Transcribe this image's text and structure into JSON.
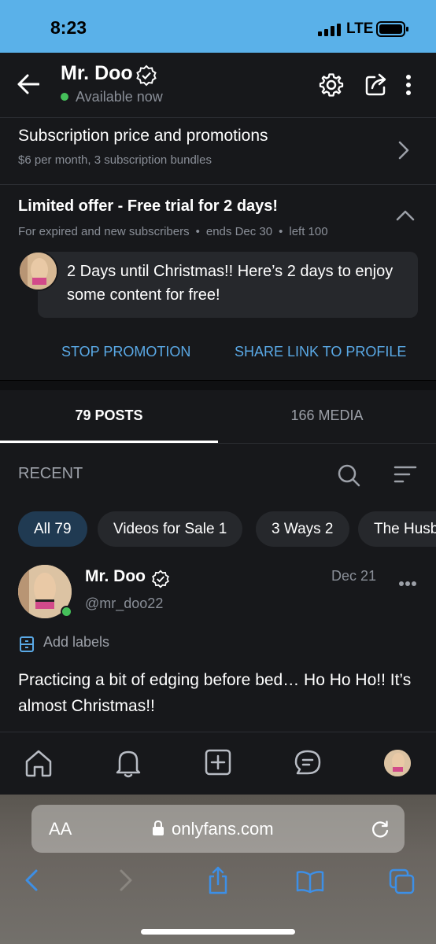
{
  "status": {
    "time": "8:23",
    "network": "LTE"
  },
  "header": {
    "name": "Mr. Doo",
    "availability": "Available now"
  },
  "subscription": {
    "title": "Subscription price and promotions",
    "description": "$6 per month, 3 subscription bundles"
  },
  "promo": {
    "title": "Limited offer - Free trial for 2 days!",
    "audience": "For expired and new subscribers",
    "ends": "ends Dec 30",
    "left": "left 100",
    "message": "2 Days until Christmas!! Here’s 2 days to enjoy some content for free!",
    "stop_label": "STOP PROMOTION",
    "share_label": "SHARE LINK TO PROFILE"
  },
  "tabs": {
    "posts": "79 POSTS",
    "media": "166 MEDIA"
  },
  "recent": {
    "label": "RECENT",
    "chips": [
      "All 79",
      "Videos for Sale 1",
      "3 Ways 2",
      "The Husb"
    ]
  },
  "post": {
    "name": "Mr. Doo",
    "username": "@mr_doo22",
    "date": "Dec 21",
    "add_labels": "Add labels",
    "text": "Practicing a bit of edging before bed… Ho Ho Ho!! It’s almost Christmas!!"
  },
  "browser": {
    "aa": "AA",
    "url": "onlyfans.com"
  },
  "colors": {
    "accent": "#5aa9e6",
    "online": "#45c05a",
    "status_bar": "#5ab1e9"
  }
}
